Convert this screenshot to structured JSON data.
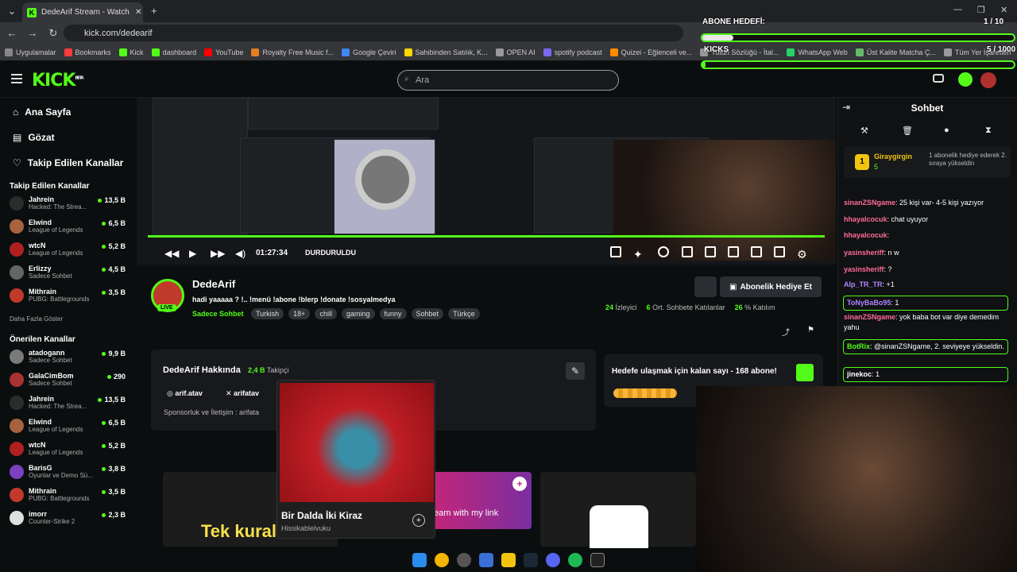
{
  "browser": {
    "tab_title": "DedeArif Stream - Watch Live o",
    "url": "kick.com/dedearif",
    "bookmarks": [
      "Uygulamalar",
      "Bookmarks",
      "Kick",
      "dashboard",
      "YouTube",
      "Royalty Free Music f...",
      "Google Çeviri",
      "Sahibinden Satılık, K...",
      "OPEN AI",
      "spotify podcast",
      "Quizei - Eğlenceli ve...",
      "Tutun Sözlüğü - İtal...",
      "WhatsApp Web",
      "Üst Kalite Matcha Ç...",
      "Tüm Yer İşaretleri"
    ]
  },
  "header": {
    "logo": "KICK",
    "beta": "BETA",
    "search_placeholder": "Ara"
  },
  "sidebar": {
    "nav": [
      {
        "label": "Ana Sayfa",
        "icon": "home-icon"
      },
      {
        "label": "Gözat",
        "icon": "browse-icon"
      },
      {
        "label": "Takip Edilen Kanallar",
        "icon": "heart-icon"
      }
    ],
    "followed_title": "Takip Edilen Kanallar",
    "followed": [
      {
        "name": "Jahrein",
        "game": "Hacked: The Strea...",
        "viewers": "13,5 B",
        "color": "#2c2c2c"
      },
      {
        "name": "Elwind",
        "game": "League of Legends",
        "viewers": "6,5 B",
        "color": "#a8623e"
      },
      {
        "name": "wtcN",
        "game": "League of Legends",
        "viewers": "5,2 B",
        "color": "#b02020"
      },
      {
        "name": "Erlizzy",
        "game": "Sadece Sohbet",
        "viewers": "4,5 B",
        "color": "#666"
      },
      {
        "name": "Mithrain",
        "game": "PUBG: Battlegrounds",
        "viewers": "3,5 B",
        "color": "#c0392b"
      }
    ],
    "more_label": "Daha Fazla Göster",
    "recommended_title": "Önerilen Kanallar",
    "recommended": [
      {
        "name": "atadogann",
        "game": "Sadece Sohbet",
        "viewers": "9,9 B",
        "color": "#7a7a7a"
      },
      {
        "name": "GalaCimBom",
        "game": "Sadece Sohbet",
        "viewers": "290",
        "color": "#a83232"
      },
      {
        "name": "Jahrein",
        "game": "Hacked: The Strea...",
        "viewers": "13,5 B",
        "color": "#2c2c2c"
      },
      {
        "name": "Elwind",
        "game": "League of Legends",
        "viewers": "6,5 B",
        "color": "#a8623e"
      },
      {
        "name": "wtcN",
        "game": "League of Legends",
        "viewers": "5,2 B",
        "color": "#b02020"
      },
      {
        "name": "BarisG",
        "game": "Oyunlar ve Demo Sü...",
        "viewers": "3,8 B",
        "color": "#7b3fbf"
      },
      {
        "name": "Mithrain",
        "game": "PUBG: Battlegrounds",
        "viewers": "3,5 B",
        "color": "#c0392b"
      },
      {
        "name": "imorr",
        "game": "Counter-Strike 2",
        "viewers": "2,3 B",
        "color": "#e0e0e0"
      }
    ]
  },
  "player": {
    "time": "01:27:34",
    "state": "DURDURULDU"
  },
  "stream": {
    "name": "DedeArif",
    "live": "LIVE",
    "title": "hadi yaaaaa ? !.. !menü !abone !blerp !donate !sosyalmedya",
    "category": "Sadece Sohbet",
    "tags": [
      "Turkish",
      "18+",
      "chill",
      "gaming",
      "funny",
      "Sohbet",
      "Türkçe"
    ],
    "gift_button": "Abonelik Hediye Et",
    "viewers": "24",
    "viewers_label": "İzleyici",
    "chatters": "6",
    "chatters_label": "Ort. Sohbete Katılanlar",
    "participation": "26",
    "participation_label": "% Katılım"
  },
  "about": {
    "title": "DedeArif Hakkında",
    "followers": "2,4 B",
    "followers_label": "Takipçi",
    "instagram": "arif.atav",
    "x": "arifatav",
    "sponsor": "Sponsorluk ve İletişim : arifata"
  },
  "goal": {
    "text": "Hedefe ulaşmak için kalan sayı - 168 abone!"
  },
  "panels": {
    "slogan": "Tek kural",
    "stream_link": "eam with my link"
  },
  "song": {
    "title": "Bir Dalda İki Kiraz",
    "artist": "Hissikablelvuku"
  },
  "chat": {
    "title": "Sohbet",
    "pinned_user": "Giraygirgin",
    "pinned_count": "5",
    "pinned_text": "1 abonelik hediye ederek 2. sıraya yükseldin",
    "messages": [
      {
        "user": "sinanZSNgame",
        "text": "25 kişi var- 4-5 kişi yazıyor",
        "color": "#ff6b9a"
      },
      {
        "user": "hhayalcocuk",
        "text": "chat uyuyor",
        "color": "#ff6b9a"
      },
      {
        "user": "hhayalcocuk",
        "text": "",
        "color": "#ff6b9a"
      },
      {
        "user": "yasinsheriff",
        "text": "n w",
        "color": "#ff6b9a"
      },
      {
        "user": "yasinsheriff",
        "text": "?",
        "color": "#ff6b9a"
      },
      {
        "user": "Alp_TR_TR",
        "text": "+1",
        "color": "#b084ff"
      },
      {
        "user": "ToNyBaBo95",
        "text": "1",
        "color": "#b084ff"
      },
      {
        "user": "sinanZSNgame",
        "text": "yok baba bot var diye demedim yahu",
        "color": "#ff6b9a"
      },
      {
        "user": "BotRix",
        "text": "@sinanZSNgame, 2. seviyeye yükseldin.",
        "color": "#53fc18"
      },
      {
        "user": "jinekoc",
        "text": "1",
        "color": "#fff"
      }
    ]
  },
  "overlay": {
    "goal_label": "ABONE HEDEFİ:",
    "goal_progress": "1 / 10",
    "goal_fraction": 0.1,
    "kicks_label": "KICKS",
    "kicks_progress": "5 / 1000",
    "kicks_fraction": 0.005
  }
}
